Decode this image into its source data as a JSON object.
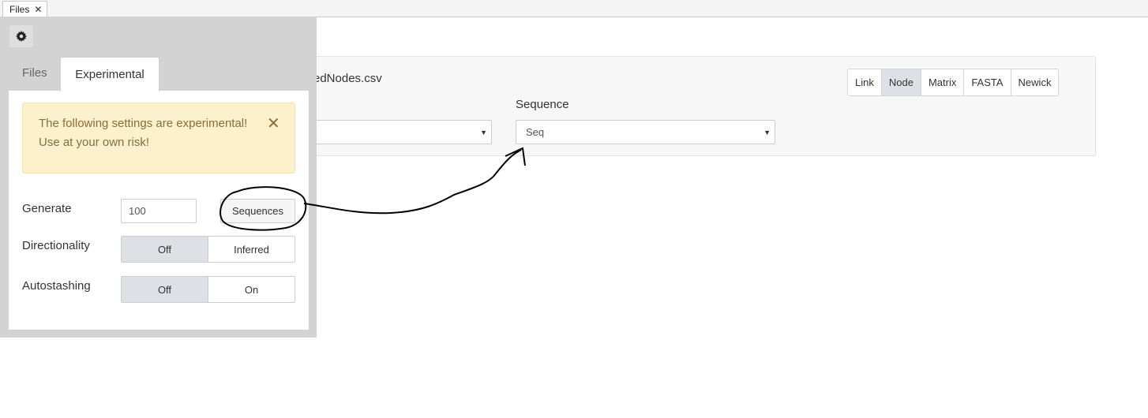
{
  "tab": {
    "label": "Files",
    "close_glyph": "✕"
  },
  "main": {
    "filename": "edNodes.csv",
    "sequence_label": "Sequence",
    "left_select_value": "",
    "sequence_select_value": "Seq",
    "view_buttons": [
      "Link",
      "Node",
      "Matrix",
      "FASTA",
      "Newick"
    ],
    "active_view": "Node"
  },
  "panel": {
    "gear_icon": "gear-icon",
    "tabs": {
      "files": "Files",
      "experimental": "Experimental"
    },
    "alert": {
      "text": "The following settings are experimental! Use at your own risk!",
      "close_glyph": "✕"
    },
    "generate": {
      "label": "Generate",
      "value": "100",
      "button": "Sequences"
    },
    "directionality": {
      "label": "Directionality",
      "options": [
        "Off",
        "Inferred"
      ],
      "active": "Off"
    },
    "autostashing": {
      "label": "Autostashing",
      "options": [
        "Off",
        "On"
      ],
      "active": "Off"
    }
  },
  "colors": {
    "alert_bg": "#fcf1cc",
    "alert_text": "#8a6d3b",
    "active_btn": "#dde0e4",
    "panel_bg": "#d3d3d3"
  }
}
